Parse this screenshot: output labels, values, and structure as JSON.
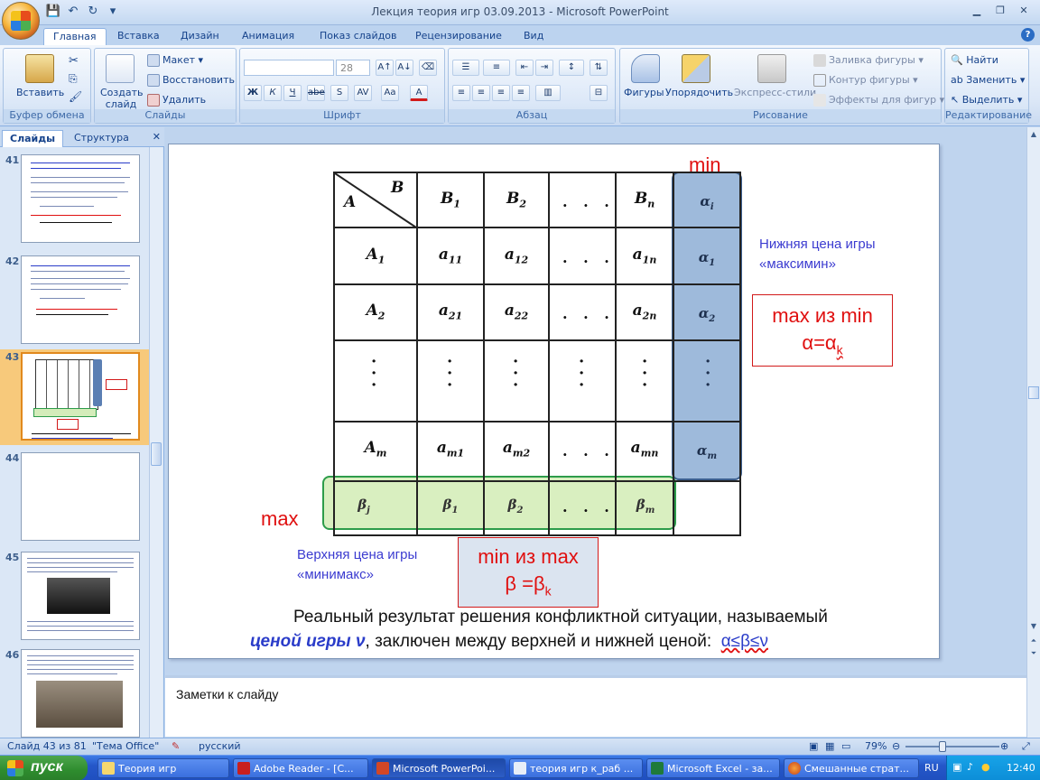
{
  "window": {
    "title": "Лекция теория игр 03.09.2013 - Microsoft PowerPoint"
  },
  "tabs": [
    "Главная",
    "Вставка",
    "Дизайн",
    "Анимация",
    "Показ слайдов",
    "Рецензирование",
    "Вид"
  ],
  "ribbon": {
    "clipboard": {
      "paste": "Вставить",
      "label": "Буфер обмена"
    },
    "slides": {
      "new_slide": "Создать слайд",
      "layout": "Макет",
      "reset": "Восстановить",
      "delete": "Удалить",
      "label": "Слайды"
    },
    "font": {
      "size": "28",
      "label": "Шрифт",
      "bold": "Ж",
      "italic": "К",
      "underline": "Ч",
      "strike": "abe",
      "shadow": "S",
      "spacing": "AV",
      "case": "Aa",
      "color": "A"
    },
    "paragraph": {
      "label": "Абзац"
    },
    "drawing": {
      "shapes": "Фигуры",
      "arrange": "Упорядочить",
      "quick_styles": "Экспресс-стили",
      "fill": "Заливка фигуры",
      "outline": "Контур фигуры",
      "effects": "Эффекты для фигур",
      "label": "Рисование"
    },
    "editing": {
      "find": "Найти",
      "replace": "Заменить",
      "select": "Выделить",
      "label": "Редактирование"
    }
  },
  "left_pane": {
    "tabs": [
      "Слайды",
      "Структура"
    ],
    "slide_numbers": [
      "41",
      "42",
      "43",
      "44",
      "45",
      "46"
    ],
    "selected": "43"
  },
  "slide": {
    "header_a": "A",
    "header_b": "B",
    "col_headers": [
      "B",
      "B",
      "B"
    ],
    "col_header_subs": [
      "1",
      "2",
      "n"
    ],
    "row_headers": [
      "A",
      "A",
      "A"
    ],
    "row_header_subs": [
      "1",
      "2",
      "m"
    ],
    "cells": {
      "r1": [
        "a",
        "a",
        "a"
      ],
      "r1_subs": [
        "11",
        "12",
        "1n"
      ],
      "r2": [
        "a",
        "a",
        "a"
      ],
      "r2_subs": [
        "21",
        "22",
        "2n"
      ],
      "rm": [
        "a",
        "a",
        "a"
      ],
      "rm_subs": [
        "m1",
        "m2",
        "mn"
      ]
    },
    "hdots": ". . .",
    "vdots": "·\n·\n·",
    "alpha_col": {
      "head": "α",
      "head_sub": "i",
      "items": [
        "α",
        "α",
        "α"
      ],
      "subs": [
        "1",
        "2",
        "m"
      ]
    },
    "beta_row": {
      "head": "β",
      "head_sub": "j",
      "items": [
        "β",
        "β",
        "β"
      ],
      "subs": [
        "1",
        "2",
        "m"
      ]
    },
    "label_min": "min",
    "label_max": "max",
    "lower_price_line1": "Нижняя цена игры",
    "lower_price_line2": "«максимин»",
    "upper_price_line1": "Верхняя цена игры",
    "upper_price_line2": "«минимакс»",
    "maxmin_box_line1": "max из min",
    "maxmin_box_line2": "α=α",
    "maxmin_box_sub": "k",
    "minmax_box_line1": "min из max",
    "minmax_box_line2": "β =β",
    "minmax_box_sub": "k",
    "caption_part1": "Реальный результат решения  конфликтной ситуации, называемый",
    "caption_emph": "ценой игры ν",
    "caption_part2": ", заключен между верхней и нижней ценой:",
    "caption_rel": "α≤β≤ν"
  },
  "notes": {
    "placeholder": "Заметки к слайду"
  },
  "status": {
    "slide_info": "Слайд 43 из 81",
    "theme": "\"Тема Office\"",
    "language": "русский",
    "zoom": "79%"
  },
  "taskbar": {
    "start": "пуск",
    "items": [
      "Теория игр",
      "Adobe Reader - [С...",
      "Microsoft PowerPoi...",
      "теория игр к_раб ...",
      "Microsoft Excel - за...",
      "Смешанные страт..."
    ],
    "lang": "RU",
    "time": "12:40"
  },
  "colors": {
    "accent": "#4f81bd",
    "green": "#2d9c4a",
    "red": "#e01010",
    "blue_text": "#3b3bd0"
  }
}
